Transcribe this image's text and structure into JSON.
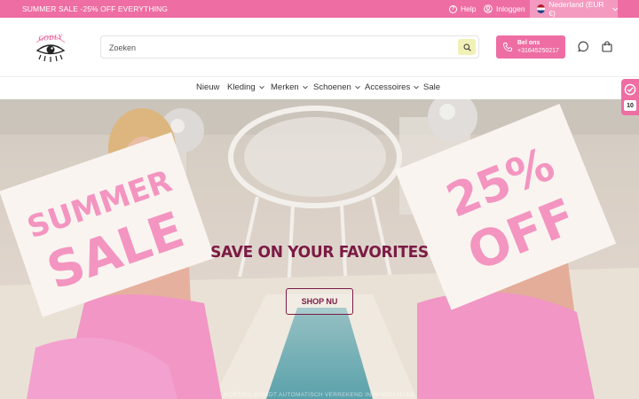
{
  "topbar": {
    "promo": "SUMMER SALE -25% OFF EVERYTHING",
    "help": "Help",
    "login": "Inloggen",
    "country": "Nederland (EUR €)"
  },
  "header": {
    "logo_text": "GODLY",
    "search_placeholder": "Zoeken",
    "call_label": "Bel ons",
    "call_number": "+31645250217"
  },
  "nav": {
    "items": [
      {
        "label": "Nieuw"
      },
      {
        "label": "Kleding"
      },
      {
        "label": "Merken"
      },
      {
        "label": "Schoenen"
      },
      {
        "label": "Accessoires"
      },
      {
        "label": "Sale"
      }
    ]
  },
  "hero": {
    "sign_left": "SUMMER SALE",
    "sign_right": "25% OFF",
    "headline": "SAVE ON YOUR FAVORITES",
    "cta": "SHOP NU",
    "footnote": "KORTING WORDT AUTOMATISCH VERREKEND IN WINKELMAND"
  },
  "review_widget": {
    "count": "10"
  },
  "colors": {
    "brand_pink": "#ee6ea3",
    "headline": "#7c1a44",
    "search_button": "#f1f1b7"
  }
}
